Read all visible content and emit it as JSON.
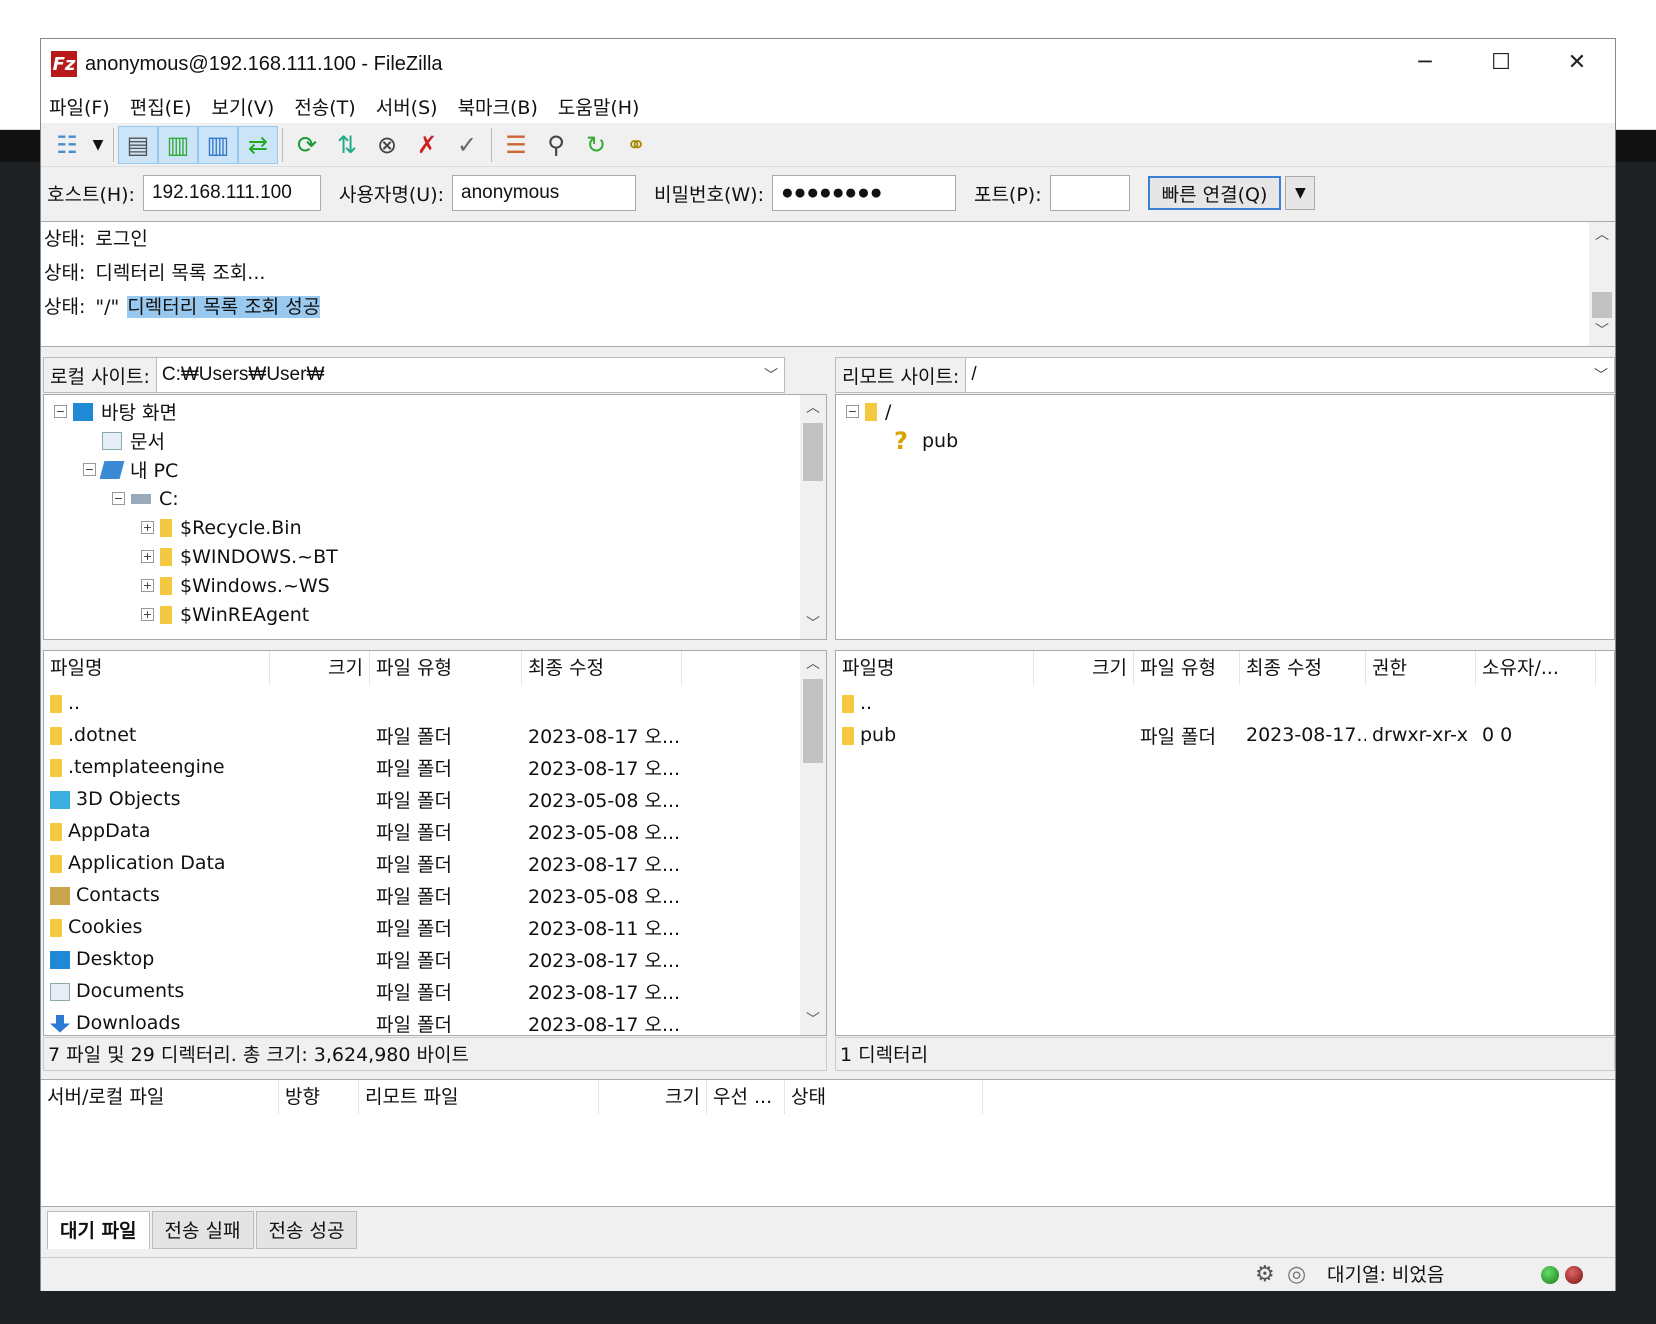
{
  "window": {
    "title": "anonymous@192.168.111.100 - FileZilla",
    "logo": "FZ"
  },
  "menu": [
    "파일(F)",
    "편집(E)",
    "보기(V)",
    "전송(T)",
    "서버(S)",
    "북마크(B)",
    "도움말(H)"
  ],
  "toolbar": [
    "site-manager",
    "dropdown",
    "toggle-log",
    "toggle-local-tree",
    "toggle-remote-tree",
    "toggle-queue",
    "refresh",
    "process-queue",
    "cancel",
    "disconnect",
    "reconnect",
    "directory-compare",
    "filter",
    "sync-browse",
    "search"
  ],
  "quickconnect": {
    "host_label": "호스트(H):",
    "host": "192.168.111.100",
    "user_label": "사용자명(U):",
    "user": "anonymous",
    "pass_label": "비밀번호(W):",
    "pass": "●●●●●●●●",
    "port_label": "포트(P):",
    "port": "",
    "button": "빠른 연결(Q)"
  },
  "log": [
    {
      "prefix": "상태:",
      "text": "로그인"
    },
    {
      "prefix": "상태:",
      "text": "디렉터리 목록 조회..."
    },
    {
      "prefix": "상태:",
      "pre": "\"/\"",
      "text": "디렉터리 목록 조회 성공"
    }
  ],
  "local": {
    "label": "로컬 사이트:",
    "path": "C:₩Users₩User₩",
    "tree": [
      {
        "label": "바탕 화면",
        "level": 0,
        "pm": "−",
        "icon": "desktop"
      },
      {
        "label": "문서",
        "level": 1,
        "pm": "",
        "icon": "doc"
      },
      {
        "label": "내 PC",
        "level": 1,
        "pm": "−",
        "icon": "pc"
      },
      {
        "label": "C:",
        "level": 2,
        "pm": "−",
        "icon": "drive"
      },
      {
        "label": "$Recycle.Bin",
        "level": 3,
        "pm": "+",
        "icon": "folder"
      },
      {
        "label": "$WINDOWS.~BT",
        "level": 3,
        "pm": "+",
        "icon": "folder"
      },
      {
        "label": "$Windows.~WS",
        "level": 3,
        "pm": "+",
        "icon": "folder"
      },
      {
        "label": "$WinREAgent",
        "level": 3,
        "pm": "+",
        "icon": "folder"
      }
    ],
    "columns": [
      "파일명",
      "크기",
      "파일 유형",
      "최종 수정"
    ],
    "files": [
      [
        "..",
        "",
        "",
        ""
      ],
      [
        ".dotnet",
        "",
        "파일 폴더",
        "2023-08-17 오..."
      ],
      [
        ".templateengine",
        "",
        "파일 폴더",
        "2023-08-17 오..."
      ],
      [
        "3D Objects",
        "",
        "파일 폴더",
        "2023-05-08 오..."
      ],
      [
        "AppData",
        "",
        "파일 폴더",
        "2023-05-08 오..."
      ],
      [
        "Application Data",
        "",
        "파일 폴더",
        "2023-08-17 오..."
      ],
      [
        "Contacts",
        "",
        "파일 폴더",
        "2023-05-08 오..."
      ],
      [
        "Cookies",
        "",
        "파일 폴더",
        "2023-08-11 오..."
      ],
      [
        "Desktop",
        "",
        "파일 폴더",
        "2023-08-17 오..."
      ],
      [
        "Documents",
        "",
        "파일 폴더",
        "2023-08-17 오..."
      ],
      [
        "Downloads",
        "",
        "파일 폴더",
        "2023-08-17 오..."
      ]
    ],
    "status": "7 파일 및 29 디렉터리. 총 크기: 3,624,980 바이트"
  },
  "remote": {
    "label": "리모트 사이트:",
    "path": "/",
    "tree": [
      {
        "label": "/",
        "level": 0,
        "pm": "−",
        "icon": "folder"
      },
      {
        "label": "pub",
        "level": 1,
        "pm": "",
        "icon": "unknown"
      }
    ],
    "columns": [
      "파일명",
      "크기",
      "파일 유형",
      "최종 수정",
      "권한",
      "소유자/..."
    ],
    "files": [
      [
        "..",
        "",
        "",
        "",
        "",
        ""
      ],
      [
        "pub",
        "",
        "파일 폴더",
        "2023-08-17...",
        "drwxr-xr-x",
        "0 0"
      ]
    ],
    "status": "1 디렉터리"
  },
  "queue": {
    "columns": [
      "서버/로컬 파일",
      "방향",
      "리모트 파일",
      "크기",
      "우선 ...",
      "상태"
    ],
    "tabs": [
      "대기 파일",
      "전송 실패",
      "전송 성공"
    ]
  },
  "bottom": {
    "queue_status": "대기열: 비었음"
  },
  "colors": {
    "selection": "#99c9ef",
    "folder": "#f5c842",
    "logo": "#b8191b",
    "led_green": "#1a7a1a",
    "led_red": "#7a1010"
  }
}
